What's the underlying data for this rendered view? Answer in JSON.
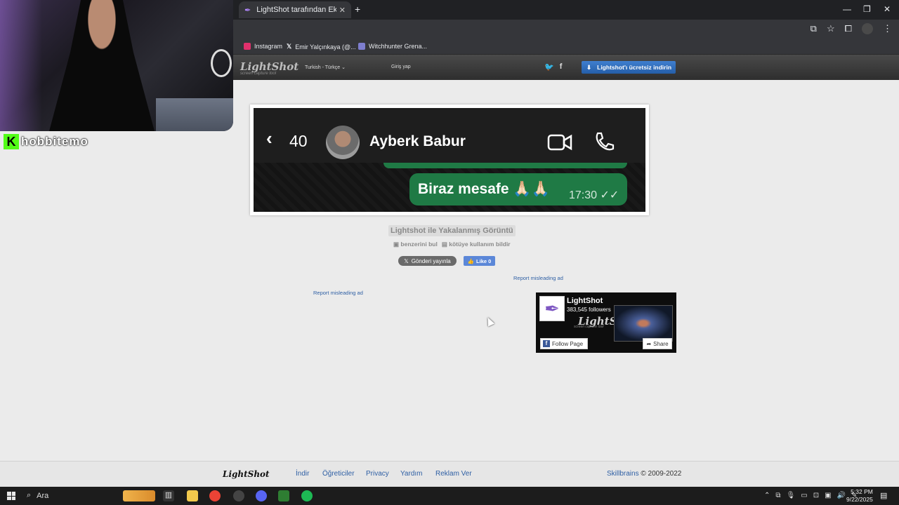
{
  "browser": {
    "tab_title": "LightShot tarafından Ekran Gör",
    "tab_close": "✕",
    "new_tab": "+",
    "minimize": "—",
    "restore": "❐",
    "close": "✕",
    "bookmarks": [
      {
        "label": "Instagram",
        "icon": "instagram-icon",
        "color": "#e1306c"
      },
      {
        "label": "Emir Yalçınkaya (@...",
        "icon": "x-icon",
        "color": "#ffffff"
      },
      {
        "label": "Witchhunter Grena...",
        "icon": "shield-icon",
        "color": "#7e7ecf"
      }
    ]
  },
  "lightshot_header": {
    "logo": "LightShot",
    "logo_sub": "screen capture tool",
    "language": "Turkish - Türkçe ⌄",
    "login": "Giriş yap",
    "download_button": "Lightshot'ı ücretsiz indirin"
  },
  "screenshot": {
    "back_count": "40",
    "contact_name": "Ayberk Babur",
    "message_text": "Biraz mesafe 🙏🏻🙏🏻",
    "message_time": "17:30 ✓✓"
  },
  "caption": {
    "title": "Lightshot ile Yakalanmış Görüntü",
    "find_similar": "benzerini bul",
    "report_abuse": "kötüye kullanım bildir",
    "tweet": "Gönderi yayınla",
    "like": "Like 0"
  },
  "ads": {
    "report_right": "Report misleading ad",
    "report_left": "Report misleading ad"
  },
  "facebook_widget": {
    "name": "LightShot",
    "followers": "383,545 followers",
    "cover_logo": "LightShot",
    "cover_sub": "screen capture tool",
    "follow": "Follow Page",
    "share": "Share"
  },
  "footer": {
    "logo": "LightShot",
    "links": [
      "İndir",
      "Öğreticiler",
      "Privacy",
      "Yardım",
      "Reklam Ver"
    ],
    "copyright_link": "Skillbrains",
    "copyright_text": " © 2009-2022"
  },
  "taskbar": {
    "search": "Ara",
    "time": "5:32 PM",
    "date": "9/22/2025",
    "notification_count": "6"
  },
  "stream": {
    "streamer_name": "hobbitemo",
    "platform_letter": "K"
  }
}
